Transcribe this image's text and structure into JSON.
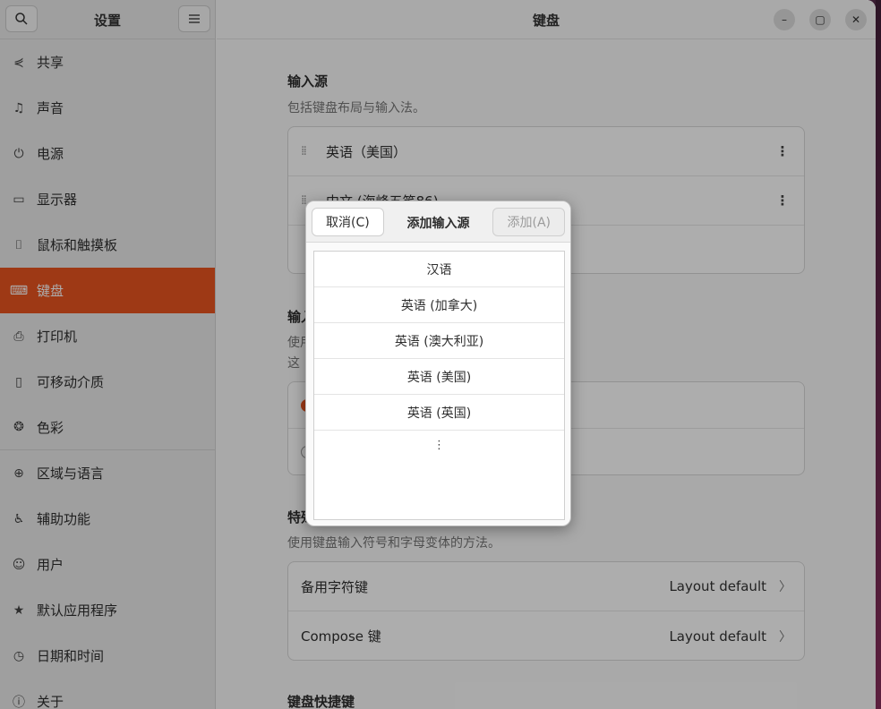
{
  "sidebar": {
    "title": "设置",
    "items": [
      {
        "label": "共享",
        "icon": "share-icon"
      },
      {
        "label": "声音",
        "icon": "music-note-icon"
      },
      {
        "label": "电源",
        "icon": "power-icon"
      },
      {
        "label": "显示器",
        "icon": "display-icon"
      },
      {
        "label": "鼠标和触摸板",
        "icon": "mouse-icon"
      },
      {
        "label": "键盘",
        "icon": "keyboard-icon",
        "active": true
      },
      {
        "label": "打印机",
        "icon": "printer-icon"
      },
      {
        "label": "可移动介质",
        "icon": "removable-media-icon"
      },
      {
        "label": "色彩",
        "icon": "color-icon"
      },
      {
        "label": "区域与语言",
        "icon": "globe-icon"
      },
      {
        "label": "辅助功能",
        "icon": "accessibility-icon"
      },
      {
        "label": "用户",
        "icon": "user-icon"
      },
      {
        "label": "默认应用程序",
        "icon": "star-icon"
      },
      {
        "label": "日期和时间",
        "icon": "clock-icon"
      },
      {
        "label": "关于",
        "icon": "info-icon"
      }
    ]
  },
  "main": {
    "title": "键盘",
    "input_sources": {
      "title": "输入源",
      "subtitle": "包括键盘布局与输入法。",
      "rows": [
        "英语（美国）",
        "中文 (海峰五笔86)"
      ]
    },
    "switching": {
      "title": "输入源切换",
      "subtitle_1": "使用",
      "subtitle_2": "这"
    },
    "special": {
      "title": "特殊字符输入",
      "subtitle": "使用键盘输入符号和字母变体的方法。",
      "rows": [
        {
          "label": "备用字符键",
          "value": "Layout default"
        },
        {
          "label": "Compose 键",
          "value": "Layout default"
        }
      ]
    },
    "shortcuts": {
      "title": "键盘快捷键"
    }
  },
  "dialog": {
    "cancel_label": "取消(C)",
    "title": "添加输入源",
    "add_label": "添加(A)",
    "items": [
      "汉语",
      "英语 (加拿大)",
      "英语 (澳大利亚)",
      "英语 (美国)",
      "英语 (英国)"
    ],
    "more": "⋮"
  },
  "colors": {
    "accent": "#e95420"
  }
}
